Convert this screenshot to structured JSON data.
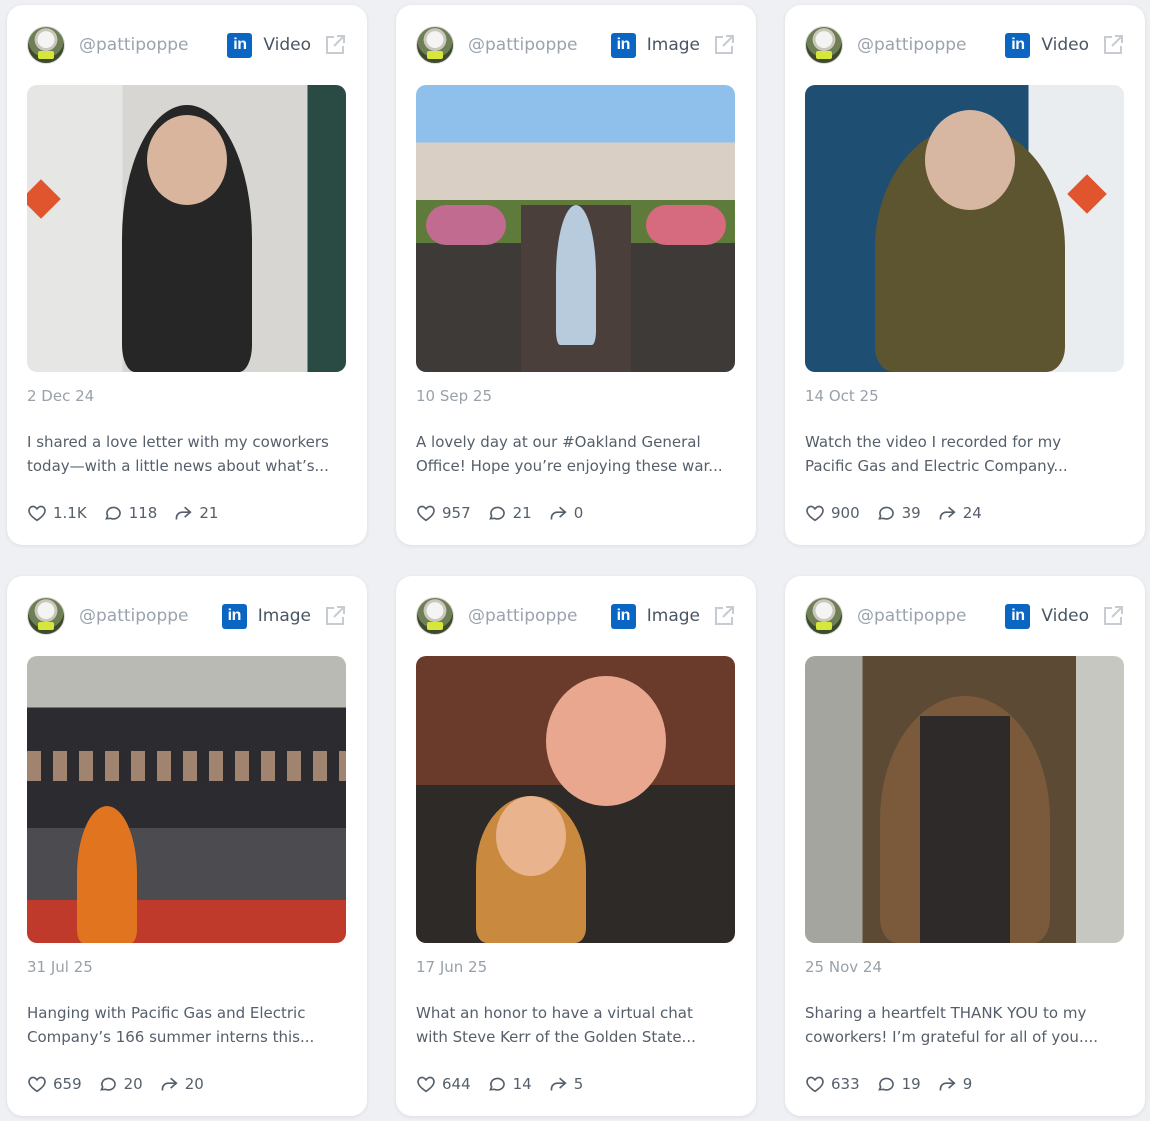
{
  "posts": [
    {
      "handle": "@pattipoppe",
      "type": "Video",
      "date": "2 Dec 24",
      "caption_lines": [
        "I shared a love letter with my coworkers",
        "today—with a little news about what’s..."
      ],
      "likes": "1.1K",
      "comments": "118",
      "shares": "21"
    },
    {
      "handle": "@pattipoppe",
      "type": "Image",
      "date": "10 Sep 25",
      "caption_lines": [
        "A lovely day at our #Oakland General",
        "Office! Hope you’re enjoying these war..."
      ],
      "likes": "957",
      "comments": "21",
      "shares": "0"
    },
    {
      "handle": "@pattipoppe",
      "type": "Video",
      "date": "14 Oct 25",
      "caption_lines": [
        "Watch the video I recorded for my",
        "Pacific Gas and Electric Company..."
      ],
      "likes": "900",
      "comments": "39",
      "shares": "24"
    },
    {
      "handle": "@pattipoppe",
      "type": "Image",
      "date": "31 Jul 25",
      "caption_lines": [
        "Hanging with Pacific Gas and Electric",
        "Company’s 166 summer interns this..."
      ],
      "likes": "659",
      "comments": "20",
      "shares": "20"
    },
    {
      "handle": "@pattipoppe",
      "type": "Image",
      "date": "17 Jun 25",
      "caption_lines": [
        "What an honor to have a virtual chat",
        "with Steve Kerr of the Golden State..."
      ],
      "likes": "644",
      "comments": "14",
      "shares": "5"
    },
    {
      "handle": "@pattipoppe",
      "type": "Video",
      "date": "25 Nov 24",
      "caption_lines": [
        "Sharing a heartfelt THANK YOU to my",
        "coworkers! I’m grateful for all of you...."
      ],
      "likes": "633",
      "comments": "19",
      "shares": "9"
    }
  ],
  "icons": {
    "platform": "linkedin-icon",
    "open": "external-link-icon",
    "like": "heart-icon",
    "comment": "comment-icon",
    "share": "share-icon"
  },
  "colors": {
    "linkedin": "#0a66c2",
    "card": "#ffffff",
    "background": "#eef0f3"
  }
}
